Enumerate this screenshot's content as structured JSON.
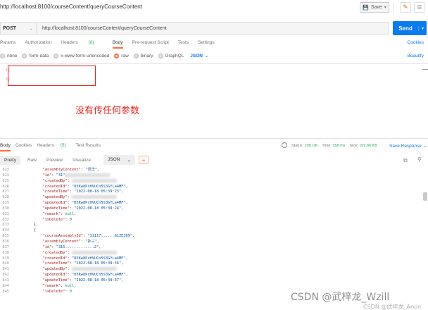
{
  "header": {
    "url_title": "http://localhost:8100/courseContent/queryCourseContent",
    "save_label": "Save",
    "edit_icon": "pencil-icon",
    "doc_icon": "document-icon"
  },
  "request": {
    "method": "POST",
    "url": "http://localhost:8100/courseContent/queryCourseContent",
    "send_label": "Send"
  },
  "request_tabs": {
    "params": "Params",
    "authorization": "Authorization",
    "headers": "Headers",
    "headers_count": "(8)",
    "body": "Body",
    "pre_request": "Pre-request Script",
    "tests": "Tests",
    "settings": "Settings",
    "cookies": "Cookies"
  },
  "body_types": {
    "none": "none",
    "form_data": "form-data",
    "urlencoded": "x-www-form-urlencoded",
    "raw": "raw",
    "binary": "binary",
    "graphql": "GraphQL",
    "language": "JSON",
    "beautify": "Beautify"
  },
  "editor": {
    "line1": "1",
    "line2": "2",
    "open": "{",
    "close": "}"
  },
  "annotation": "没有传任何参数",
  "response_tabs": {
    "body": "Body",
    "cookies": "Cookies",
    "headers": "Headers",
    "headers_count": "(5)",
    "test_results": "Test Results"
  },
  "status": {
    "status_label": "Status:",
    "status_value": "200 OK",
    "time_label": "Time:",
    "time_value": "558 ms",
    "size_label": "Size:",
    "size_value": "109.86 KB",
    "save_response": "Save Response"
  },
  "view": {
    "pretty": "Pretty",
    "raw": "Raw",
    "preview": "Preview",
    "visualize": "Visualize",
    "format": "JSON"
  },
  "code_lines": [
    {
      "n": "823",
      "indent": "        ",
      "key": "\"assemblyContent\"",
      "val": "\"讯华\","
    },
    {
      "n": "824",
      "indent": "        ",
      "key": "\"id\"",
      "val": "\"31\"",
      "blur": true
    },
    {
      "n": "825",
      "indent": "        ",
      "key": "\"createdBy\"",
      "val": "",
      "blur": true
    },
    {
      "n": "826",
      "indent": "        ",
      "key": "\"createdId\"",
      "val": "\"D5Kw8PcHVUCn5S3GYLa4MF\","
    },
    {
      "n": "827",
      "indent": "        ",
      "key": "\"createTime\"",
      "val": "\"2022-08-18 05:39:23\","
    },
    {
      "n": "828",
      "indent": "        ",
      "key": "\"updatedBy\"",
      "val": "",
      "blur": true
    },
    {
      "n": "829",
      "indent": "        ",
      "key": "\"updatedId\"",
      "val": "\"D5Kw8PcHVUCn5S3GYLa4MF\","
    },
    {
      "n": "830",
      "indent": "        ",
      "key": "\"updateTime\"",
      "val": "\"2022-08-18 05:39:24\","
    },
    {
      "n": "831",
      "indent": "        ",
      "key": "\"remark\"",
      "val": "null,"
    },
    {
      "n": "832",
      "indent": "        ",
      "key": "\"isDelete\"",
      "val": "0"
    },
    {
      "n": "833",
      "indent": "    ",
      "raw": "},"
    },
    {
      "n": "834",
      "indent": "    ",
      "raw": "{"
    },
    {
      "n": "835",
      "indent": "        ",
      "key": "\"courseAssemblyId\"",
      "val": "\"31117......G1ZE309\","
    },
    {
      "n": "836",
      "indent": "        ",
      "key": "\"assemblyContent\"",
      "val": "\"补三\","
    },
    {
      "n": "837",
      "indent": "        ",
      "key": "\"id\"",
      "val": "\"315.............2\","
    },
    {
      "n": "838",
      "indent": "        ",
      "key": "\"createdBy\"",
      "val": "",
      "blur": true
    },
    {
      "n": "839",
      "indent": "        ",
      "key": "\"createdId\"",
      "val": "\"D5Kw8PcHVUCn5S3GYLa4MF\","
    },
    {
      "n": "840",
      "indent": "        ",
      "key": "\"createTime\"",
      "val": "\"2022-08-18 05:39:36\","
    },
    {
      "n": "841",
      "indent": "        ",
      "key": "\"updatedBy\"",
      "val": "",
      "blur": true
    },
    {
      "n": "842",
      "indent": "        ",
      "key": "\"updatedId\"",
      "val": "\"D5Kw8PcHVUCn5S3GYLa4MF\","
    },
    {
      "n": "843",
      "indent": "        ",
      "key": "\"updateTime\"",
      "val": "\"2022-08-18 05:39:37\","
    },
    {
      "n": "844",
      "indent": "        ",
      "key": "\"remark\"",
      "val": "null,"
    },
    {
      "n": "845",
      "indent": "        ",
      "key": "\"isDelete\"",
      "val": "0"
    }
  ],
  "watermark": "CSDN @武梓龙_Wzill",
  "watermark2": "CSDN @武梓龙_Arvin"
}
